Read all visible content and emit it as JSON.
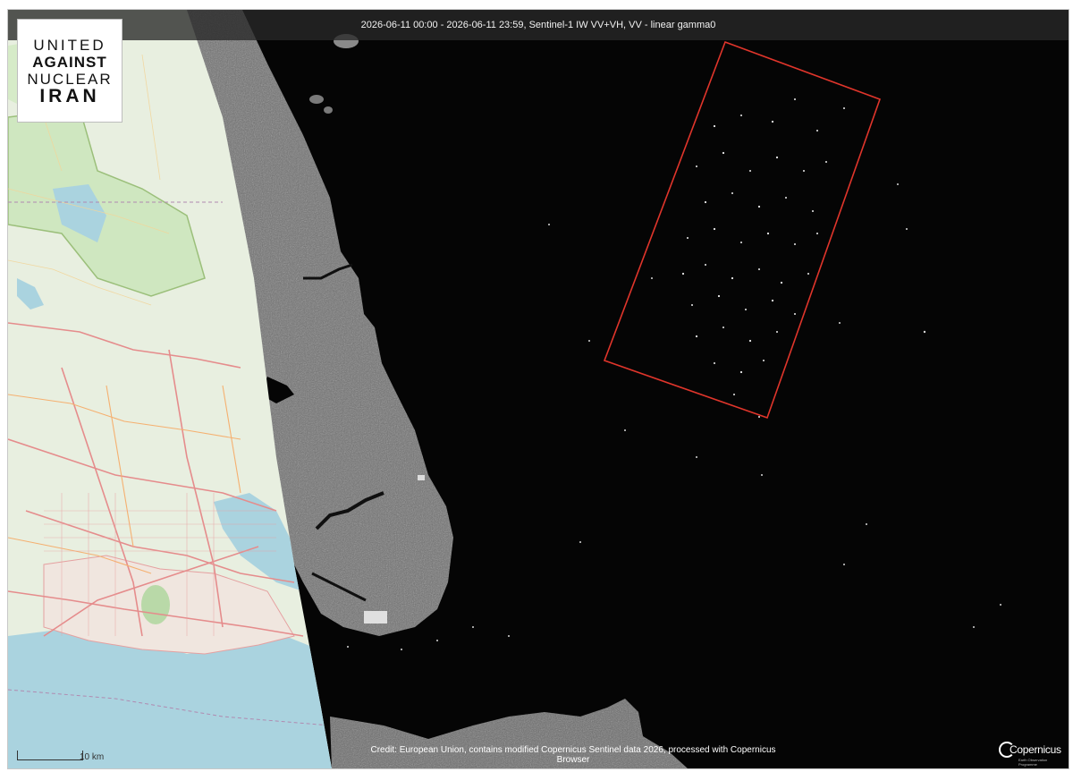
{
  "header": {
    "title": "2026-06-11 00:00 - 2026-06-11 23:59, Sentinel-1 IW VV+VH, VV - linear gamma0"
  },
  "logo": {
    "line1": "UNITED",
    "line2": "AGAINST",
    "line3": "NUCLEAR",
    "line4": "IRAN"
  },
  "scale_bar": {
    "label": "10 km"
  },
  "credit": {
    "text": "Credit: European Union, contains modified Copernicus Sentinel data 2026, processed with Copernicus Browser"
  },
  "attribution_logo": {
    "text": "Copernicus",
    "subtext": "Earth Observation Programme"
  },
  "colors": {
    "highlight_box": "#e0352b",
    "sea_dark": "#050505",
    "osm_land": "#e8efe0",
    "osm_water": "#aad3df",
    "osm_forest": "#cfe7c0"
  },
  "icons": {
    "scale": "scale-bar",
    "attribution": "copernicus-logo"
  }
}
